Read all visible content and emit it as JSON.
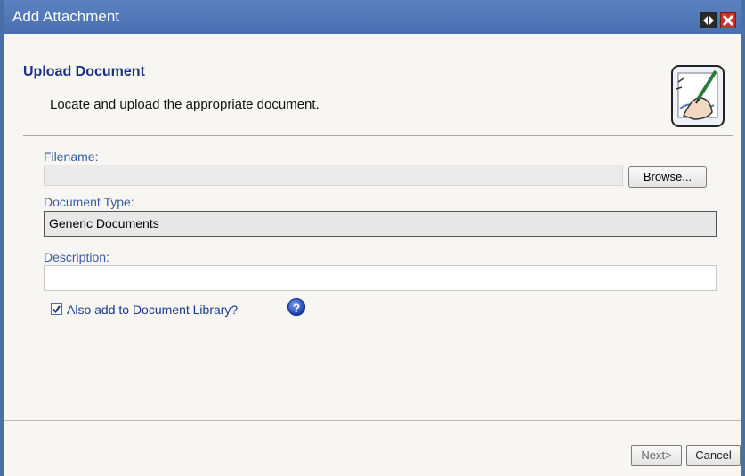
{
  "window": {
    "title": "Add Attachment"
  },
  "header": {
    "title": "Upload Document",
    "subtitle": "Locate and upload the appropriate document.",
    "icon": "writing-hand-icon"
  },
  "form": {
    "filename_label": "Filename:",
    "filename_value": "",
    "browse_label": "Browse...",
    "doctype_label": "Document Type:",
    "doctype_value": "Generic Documents",
    "description_label": "Description:",
    "description_value": "",
    "library_checkbox_label": "Also add to Document Library?",
    "library_checked": true,
    "help_icon": "question-mark-icon"
  },
  "footer": {
    "next_label": "Next>",
    "cancel_label": "Cancel"
  },
  "colors": {
    "titlebar": "#4a6fb0",
    "heading": "#1a2e8a",
    "label": "#3a5ca0",
    "close": "#c8322a"
  }
}
